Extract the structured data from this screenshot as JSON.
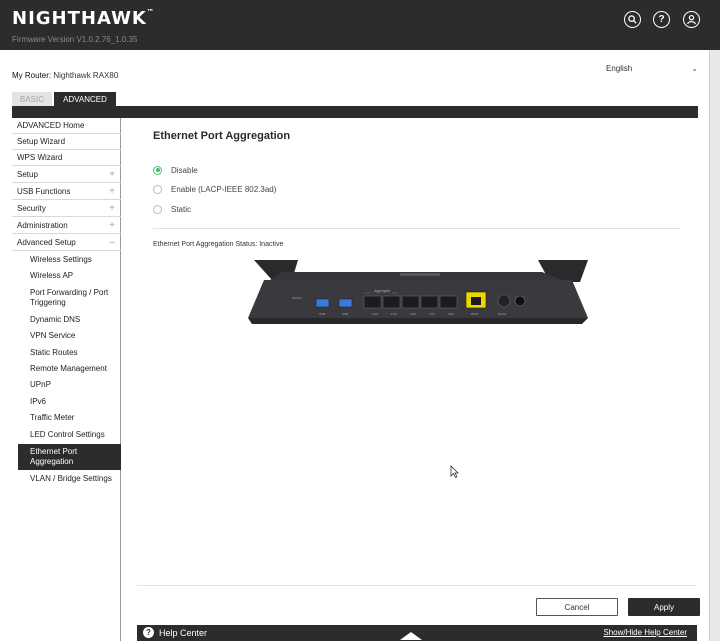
{
  "header": {
    "logo": "NIGHTHAWK",
    "firmware": "Firmware Version V1.0.2.76_1.0.35"
  },
  "router_label": "My Router:",
  "router_name": "Nighthawk RAX80",
  "language": "English",
  "tabs": {
    "basic": "BASIC",
    "advanced": "ADVANCED"
  },
  "sidebar": {
    "items": [
      {
        "label": "ADVANCED Home",
        "expand": ""
      },
      {
        "label": "Setup Wizard",
        "expand": ""
      },
      {
        "label": "WPS Wizard",
        "expand": ""
      },
      {
        "label": "Setup",
        "expand": "+"
      },
      {
        "label": "USB Functions",
        "expand": "+"
      },
      {
        "label": "Security",
        "expand": "+"
      },
      {
        "label": "Administration",
        "expand": "+"
      },
      {
        "label": "Advanced Setup",
        "expand": "–"
      }
    ],
    "subitems": [
      "Wireless Settings",
      "Wireless AP",
      "Port Forwarding / Port Triggering",
      "Dynamic DNS",
      "VPN Service",
      "Static Routes",
      "Remote Management",
      "UPnP",
      "IPv6",
      "Traffic Meter",
      "LED Control Settings",
      "Ethernet Port Aggregation",
      "VLAN / Bridge Settings"
    ]
  },
  "main": {
    "title": "Ethernet Port Aggregation",
    "options": [
      {
        "label": "Disable",
        "selected": true
      },
      {
        "label": "Enable (LACP-IEEE 802.3ad)",
        "selected": false
      },
      {
        "label": "Static",
        "selected": false
      }
    ],
    "status": "Ethernet Port Aggregation Status: Inactive",
    "router_image": {
      "aggregate_label": "Aggregate",
      "lan_label": "LAN",
      "usb_label": "USB",
      "internet_label": "WAN",
      "power_label": "Power"
    }
  },
  "buttons": {
    "cancel": "Cancel",
    "apply": "Apply"
  },
  "help": {
    "label": "Help Center",
    "toggle": "Show/Hide Help Center"
  },
  "colors": {
    "dark": "#2e2b2e",
    "radio_selected": "#3bbf5e",
    "wan_port": "#e9d900"
  }
}
